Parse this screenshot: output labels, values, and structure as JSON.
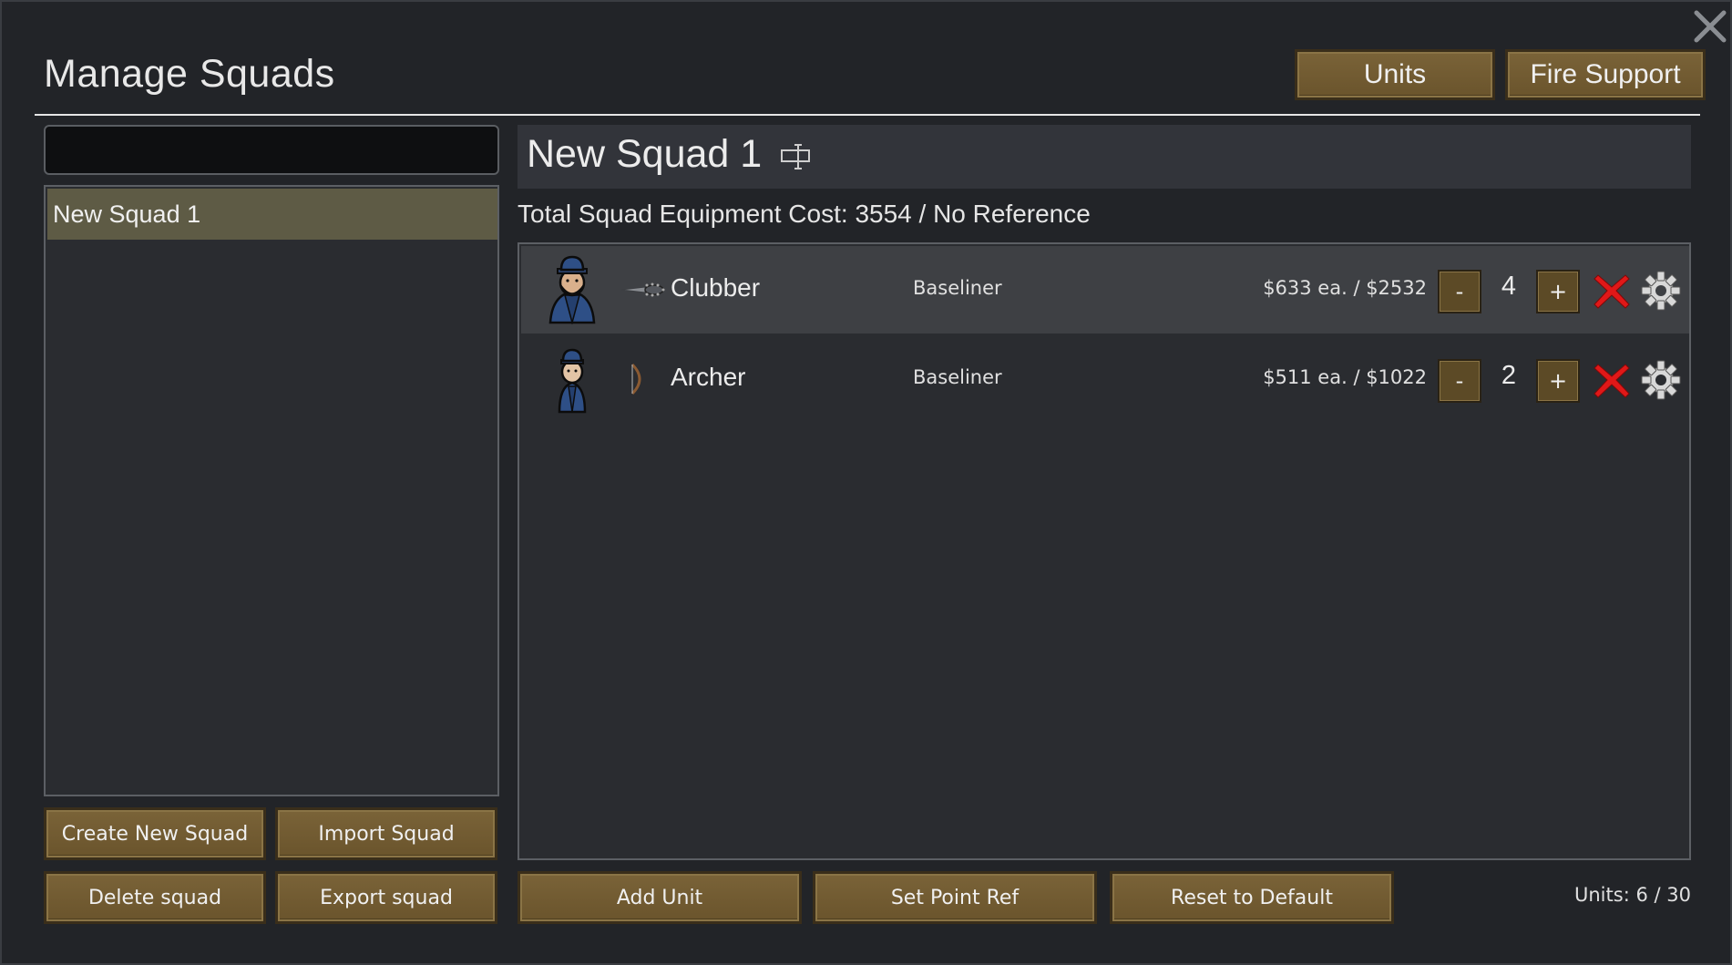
{
  "window": {
    "title": "Manage Squads",
    "close_icon": "close-icon"
  },
  "header_buttons": {
    "units_label": "Units",
    "fire_support_label": "Fire Support"
  },
  "sidebar": {
    "search": {
      "value": "",
      "placeholder": ""
    },
    "squads": [
      {
        "label": "New Squad 1",
        "selected": true
      }
    ],
    "buttons": {
      "create_label": "Create New Squad",
      "import_label": "Import Squad",
      "delete_label": "Delete squad",
      "export_label": "Export squad"
    }
  },
  "squad": {
    "name": "New Squad 1",
    "rename_icon": "rename-icon",
    "total_cost": "Total Squad Equipment Cost: 3554 / No Reference",
    "units": [
      {
        "name": "Clubber",
        "xenotype": "Baseliner",
        "cost": "$633 ea. / $2532",
        "count": "4",
        "minus_label": "-",
        "plus_label": "+",
        "weapon_icon": "club-icon",
        "portrait_icon": "pawn-portrait-icon"
      },
      {
        "name": "Archer",
        "xenotype": "Baseliner",
        "cost": "$511 ea. / $1022",
        "count": "2",
        "minus_label": "-",
        "plus_label": "+",
        "weapon_icon": "bow-icon",
        "portrait_icon": "pawn-portrait-icon"
      }
    ]
  },
  "footer": {
    "add_unit_label": "Add Unit",
    "set_point_ref_label": "Set Point Ref",
    "reset_label": "Reset to Default",
    "units_count": "Units: 6 / 30"
  },
  "colors": {
    "button_brown": "#7a6338",
    "selected_row": "#5e5b45",
    "remove_red": "#e01818",
    "background": "#222428"
  }
}
